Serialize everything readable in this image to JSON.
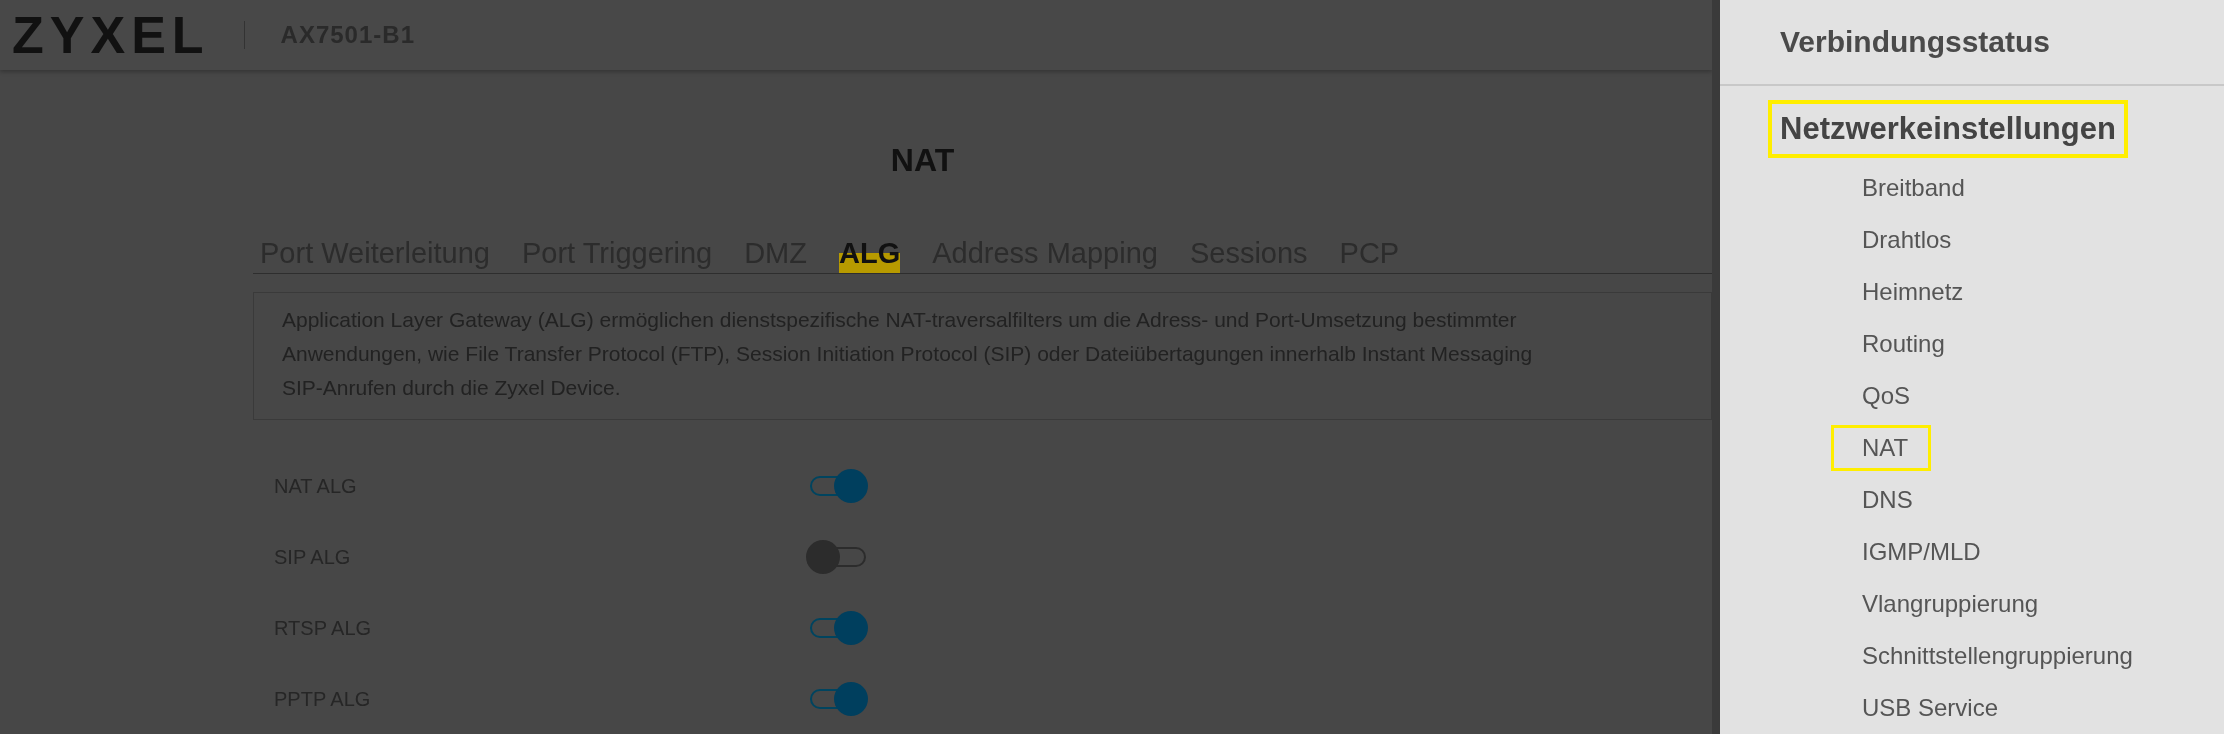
{
  "header": {
    "logo": "ZYXEL",
    "model": "AX7501-B1"
  },
  "page": {
    "title": "NAT",
    "tabs": [
      {
        "label": "Port Weiterleitung",
        "selected": false
      },
      {
        "label": "Port Triggering",
        "selected": false
      },
      {
        "label": "DMZ",
        "selected": false
      },
      {
        "label": "ALG",
        "selected": true
      },
      {
        "label": "Address Mapping",
        "selected": false
      },
      {
        "label": "Sessions",
        "selected": false
      },
      {
        "label": "PCP",
        "selected": false
      }
    ],
    "description": [
      "Application Layer Gateway (ALG) ermöglichen dienstspezifische NAT-traversalfilters um die Adress- und Port-Umsetzung bestimmter",
      "Anwendungen, wie File Transfer Protocol (FTP), Session Initiation Protocol (SIP) oder Dateiübertagungen innerhalb Instant Messaging",
      "SIP-Anrufen durch die Zyxel Device."
    ],
    "settings": [
      {
        "label": "NAT ALG",
        "on": true
      },
      {
        "label": "SIP ALG",
        "on": false
      },
      {
        "label": "RTSP ALG",
        "on": true
      },
      {
        "label": "PPTP ALG",
        "on": true
      }
    ]
  },
  "menu": {
    "top": "Verbindungsstatus",
    "section": {
      "label": "Netzwerkeinstellungen",
      "highlighted": true
    },
    "items": [
      {
        "label": "Breitband",
        "highlighted": false
      },
      {
        "label": "Drahtlos",
        "highlighted": false
      },
      {
        "label": "Heimnetz",
        "highlighted": false
      },
      {
        "label": "Routing",
        "highlighted": false
      },
      {
        "label": "QoS",
        "highlighted": false
      },
      {
        "label": "NAT",
        "highlighted": true
      },
      {
        "label": "DNS",
        "highlighted": false
      },
      {
        "label": "IGMP/MLD",
        "highlighted": false
      },
      {
        "label": "Vlangruppierung",
        "highlighted": false
      },
      {
        "label": "Schnittstellengruppierung",
        "highlighted": false
      },
      {
        "label": "USB Service",
        "highlighted": false
      }
    ]
  }
}
